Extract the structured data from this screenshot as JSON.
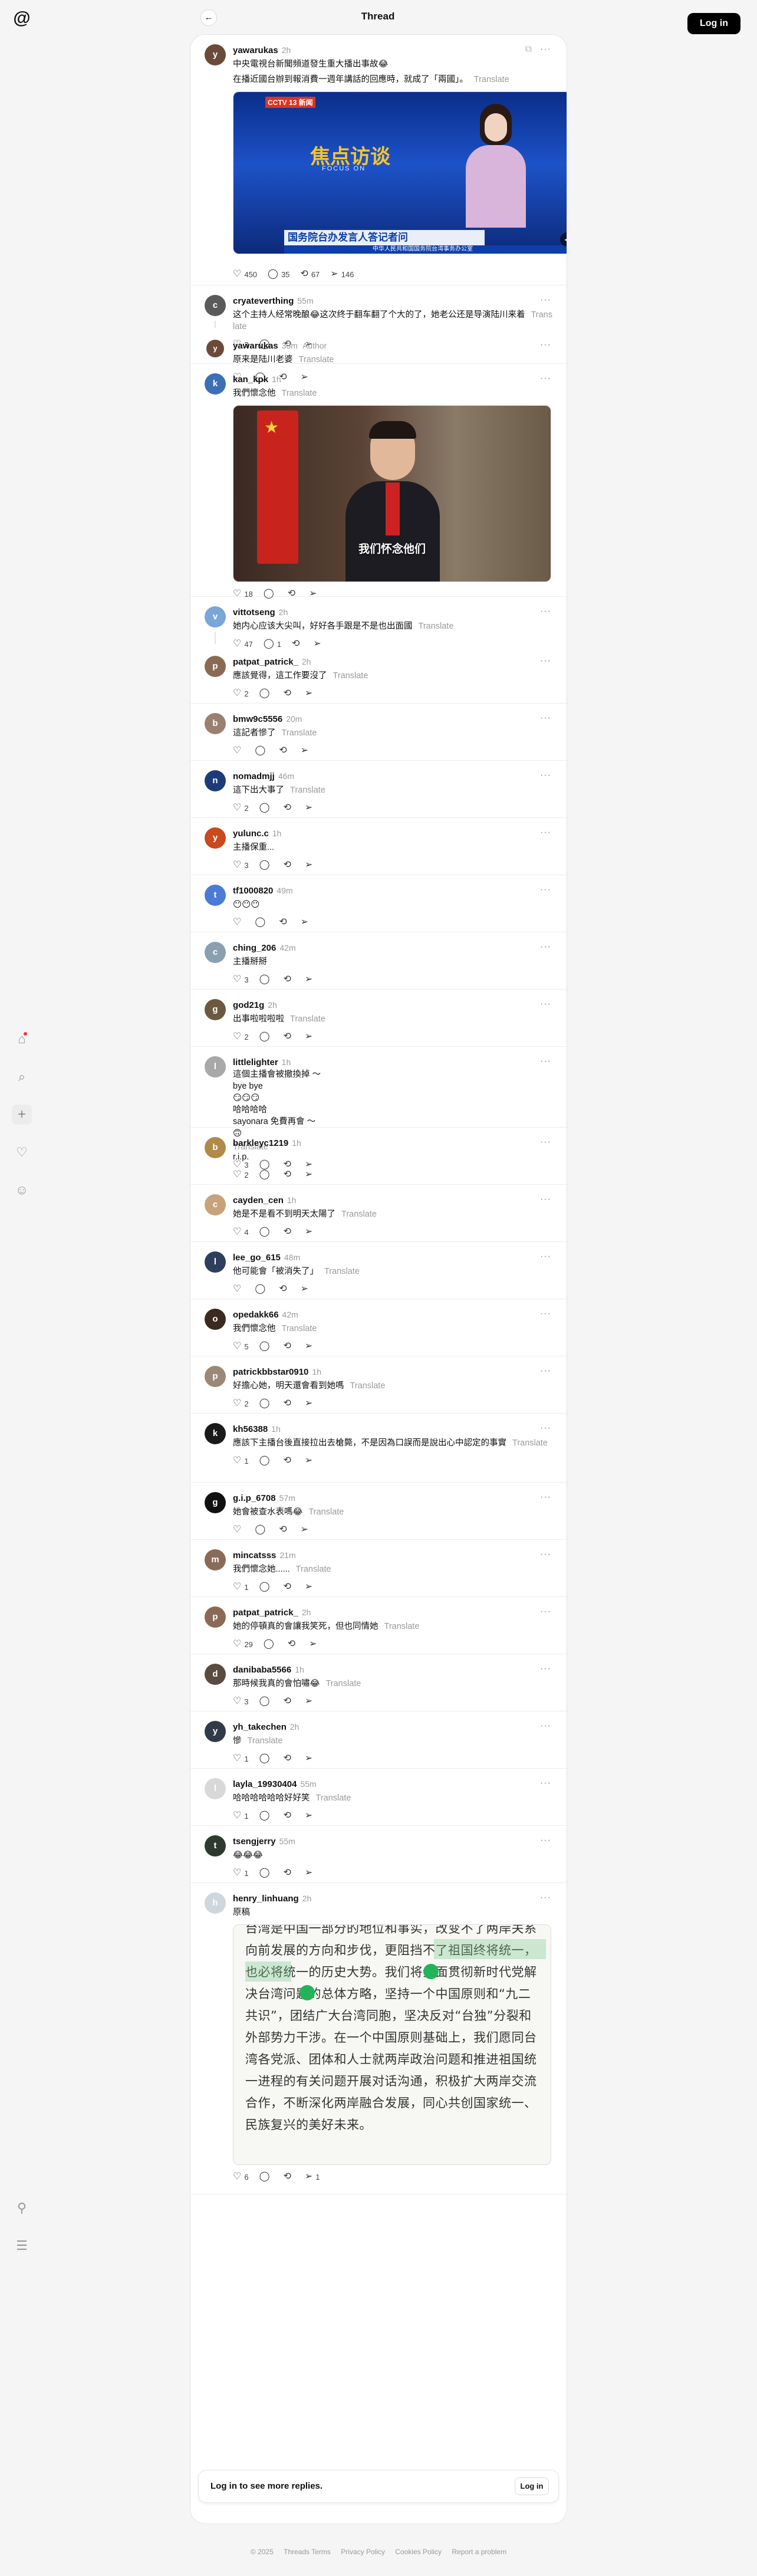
{
  "header": {
    "title": "Thread",
    "login": "Log in"
  },
  "nav": {
    "items": [
      "home-icon",
      "search-icon",
      "create-icon",
      "activity-icon",
      "profile-icon"
    ],
    "bottom": [
      "pin-icon",
      "menu-icon"
    ]
  },
  "root": {
    "username": "yawarukas",
    "time": "2h",
    "line1": "中央電視台新聞頻道發生重大播出事故😂",
    "line2": "在播近國台辦到報消費一週年講話的回應時，就成了「兩國」。",
    "translate": "Translate",
    "image": {
      "channel": "CCTV 13 新闻",
      "program": "焦点访谈",
      "focus": "FOCUS ON",
      "caption": "国务院台办发言人答记者问",
      "ticker": "中华人民共和国国务院台湾事务办公室"
    },
    "likes": "450",
    "replies": "35",
    "reposts": "67",
    "shares": "146"
  },
  "posts": [
    {
      "id": "p1",
      "username": "cryateverthing",
      "time": "55m",
      "text": "这个主持人经常晚酿😂这次终于翻车翻了个大的了，她老公还是导演陆川来着",
      "translate": "Translate",
      "likes": "3",
      "replies": "",
      "reposts": "",
      "shares": "",
      "avatar_color": "#5a5a5a",
      "avatar_char": "c",
      "thread": true
    },
    {
      "id": "p2",
      "username": "yawarukas",
      "time": "33m",
      "author": "Author",
      "text": "原来是陆川老婆",
      "translate": "Translate",
      "likes": "",
      "replies": "",
      "reposts": "",
      "shares": "",
      "avatar_color": "#6b4a3a",
      "avatar_char": "y"
    },
    {
      "id": "p3",
      "username": "kan_kpk",
      "time": "1h",
      "text": "我們懷念他",
      "translate": "Translate",
      "likes": "18",
      "replies": "",
      "reposts": "",
      "shares": "",
      "avatar_color": "#3d6fb4",
      "avatar_char": "k",
      "image": "我们怀念他们"
    },
    {
      "id": "p4",
      "username": "vittotseng",
      "time": "2h",
      "text": "她内心应该大尖叫，好好各手跟是不是也出面國",
      "translate": "Translate",
      "likes": "47",
      "replies": "1",
      "reposts": "",
      "shares": "",
      "avatar_color": "#7aa6d8",
      "avatar_char": "v",
      "thread": true
    },
    {
      "id": "p5",
      "username": "patpat_patrick_",
      "time": "2h",
      "text": "應該覺得，這工作要沒了",
      "translate": "Translate",
      "likes": "2",
      "replies": "",
      "reposts": "",
      "shares": "",
      "avatar_color": "#8a6a55",
      "avatar_char": "p"
    },
    {
      "id": "p6",
      "username": "bmw9c5556",
      "time": "20m",
      "text": "這記者慘了",
      "translate": "Translate",
      "likes": "",
      "replies": "",
      "reposts": "",
      "shares": "",
      "avatar_color": "#9a8070",
      "avatar_char": "b"
    },
    {
      "id": "p7",
      "username": "nomadmjj",
      "time": "46m",
      "text": "這下出大事了",
      "translate": "Translate",
      "likes": "2",
      "replies": "",
      "reposts": "",
      "shares": "",
      "avatar_color": "#1d3b78",
      "avatar_char": "n"
    },
    {
      "id": "p8",
      "username": "yulunc.c",
      "time": "1h",
      "text": "主播保重...",
      "translate": "",
      "likes": "3",
      "replies": "",
      "reposts": "",
      "shares": "",
      "avatar_color": "#c84a1e",
      "avatar_char": "y"
    },
    {
      "id": "p9",
      "username": "tf1000820",
      "time": "49m",
      "text": "😶😶😶",
      "translate": "",
      "likes": "",
      "replies": "",
      "reposts": "",
      "shares": "",
      "avatar_color": "#4b7bd6",
      "avatar_char": "t"
    },
    {
      "id": "p10",
      "username": "ching_206",
      "time": "42m",
      "text": "主播掰掰",
      "translate": "",
      "likes": "3",
      "replies": "",
      "reposts": "",
      "shares": "",
      "avatar_color": "#8aa0b0",
      "avatar_char": "c"
    },
    {
      "id": "p11",
      "username": "god21g",
      "time": "2h",
      "text": "出事啦啦啦啦",
      "translate": "Translate",
      "likes": "2",
      "replies": "",
      "reposts": "",
      "shares": "",
      "avatar_color": "#6b5a40",
      "avatar_char": "g"
    },
    {
      "id": "p12",
      "username": "littlelighter",
      "time": "1h",
      "lines": [
        "這個主播會被撤換掉 ～",
        "bye bye",
        "😏😏😏",
        "哈哈哈哈",
        "sayonara 免費再會 ～",
        "🙃"
      ],
      "translate": "Translate",
      "likes": "3",
      "replies": "",
      "reposts": "",
      "shares": "",
      "avatar_color": "#a8a8a8",
      "avatar_char": "l"
    },
    {
      "id": "p13",
      "username": "barkleyc1219",
      "time": "1h",
      "text": "r.i.p.",
      "translate": "",
      "likes": "2",
      "replies": "",
      "reposts": "",
      "shares": "",
      "avatar_color": "#b08a48",
      "avatar_char": "b"
    },
    {
      "id": "p14",
      "username": "cayden_cen",
      "time": "1h",
      "text": "她是不是看不到明天太陽了",
      "translate": "Translate",
      "likes": "4",
      "replies": "",
      "reposts": "",
      "shares": "",
      "avatar_color": "#c7a27a",
      "avatar_char": "c"
    },
    {
      "id": "p15",
      "username": "lee_go_615",
      "time": "48m",
      "text": "他可能會「被消失了」",
      "translate": "Translate",
      "likes": "",
      "replies": "",
      "reposts": "",
      "shares": "",
      "avatar_color": "#2e3f5e",
      "avatar_char": "l"
    },
    {
      "id": "p16",
      "username": "opedakk66",
      "time": "42m",
      "text": "我們懷念他",
      "translate": "Translate",
      "likes": "5",
      "replies": "",
      "reposts": "",
      "shares": "",
      "avatar_color": "#3a2a20",
      "avatar_char": "o"
    },
    {
      "id": "p17",
      "username": "patrickbbstar0910",
      "time": "1h",
      "text": "好擔心她，明天還會看到她嗎",
      "translate": "Translate",
      "likes": "2",
      "replies": "",
      "reposts": "",
      "shares": "",
      "avatar_color": "#9a8878",
      "avatar_char": "p"
    },
    {
      "id": "p18",
      "username": "kh56388",
      "time": "1h",
      "text": "應該下主播台後直接拉出去槍斃，不是因為口誤而是說出心中認定的事實",
      "translate": "Translate",
      "likes": "1",
      "replies": "",
      "reposts": "",
      "shares": "",
      "avatar_color": "#1a1a1a",
      "avatar_char": "k"
    },
    {
      "id": "p19",
      "username": "g.i.p_6708",
      "time": "57m",
      "text": "她會被查水表嗎😂",
      "translate": "Translate",
      "likes": "",
      "replies": "",
      "reposts": "",
      "shares": "",
      "avatar_color": "#111111",
      "avatar_char": "g"
    },
    {
      "id": "p20",
      "username": "mincatsss",
      "time": "21m",
      "text": "我們懷念她......",
      "translate": "Translate",
      "likes": "1",
      "replies": "",
      "reposts": "",
      "shares": "",
      "avatar_color": "#8a6a58",
      "avatar_char": "m"
    },
    {
      "id": "p21",
      "username": "patpat_patrick_",
      "time": "2h",
      "text": "她的停頓真的會讓我笑死，但也同情她",
      "translate": "Translate",
      "likes": "29",
      "replies": "",
      "reposts": "",
      "shares": "",
      "avatar_color": "#8a6a55",
      "avatar_char": "p"
    },
    {
      "id": "p22",
      "username": "danibaba5566",
      "time": "1h",
      "text": "那時候我真的會怕嘯😂",
      "translate": "Translate",
      "likes": "3",
      "replies": "",
      "reposts": "",
      "shares": "",
      "avatar_color": "#5a4a40",
      "avatar_char": "d"
    },
    {
      "id": "p23",
      "username": "yh_takechen",
      "time": "2h",
      "text": "慘",
      "translate": "Translate",
      "likes": "1",
      "replies": "",
      "reposts": "",
      "shares": "",
      "avatar_color": "#303a48",
      "avatar_char": "y"
    },
    {
      "id": "p24",
      "username": "layla_19930404",
      "time": "55m",
      "text": "哈哈哈哈哈哈好好笑",
      "translate": "Translate",
      "likes": "1",
      "replies": "",
      "reposts": "",
      "shares": "",
      "avatar_color": "#d8d8d8",
      "avatar_char": "l"
    },
    {
      "id": "p25",
      "username": "tsengjerry",
      "time": "55m",
      "text": "😂😂😂",
      "translate": "",
      "likes": "1",
      "replies": "",
      "reposts": "",
      "shares": "",
      "avatar_color": "#2d3a2d",
      "avatar_char": "t"
    },
    {
      "id": "p26",
      "username": "henry_linhuang",
      "time": "2h",
      "text": "原稿",
      "translate": "",
      "likes": "6",
      "replies": "",
      "reposts": "",
      "shares": "1",
      "avatar_color": "#cfd6dc",
      "avatar_char": "h",
      "doc": true
    }
  ],
  "doc_text": "台湾是中国一部分的地位和事实，改变不了两岸关系向前发展的方向和步伐，更阻挡不了祖国终将统一，也必将统一的历史大势。我们将全面贯彻新时代党解决台湾问题的总体方略，坚持一个中国原则和“九二共识”，团结广大台湾同胞，坚决反对“台独”分裂和外部势力干涉。在一个中国原则基础上，我们愿同台湾各党派、团体和人士就两岸政治问题和推进祖国统一进程的有关问题开展对话沟通，积极扩大两岸交流合作，不断深化两岸融合发展，同心共创国家统一、民族复兴的美好未来。",
  "login_bar": {
    "message": "Log in to see more replies.",
    "button": "Log in"
  },
  "footer": [
    "© 2025",
    "Threads Terms",
    "Privacy Policy",
    "Cookies Policy",
    "Report a problem"
  ]
}
